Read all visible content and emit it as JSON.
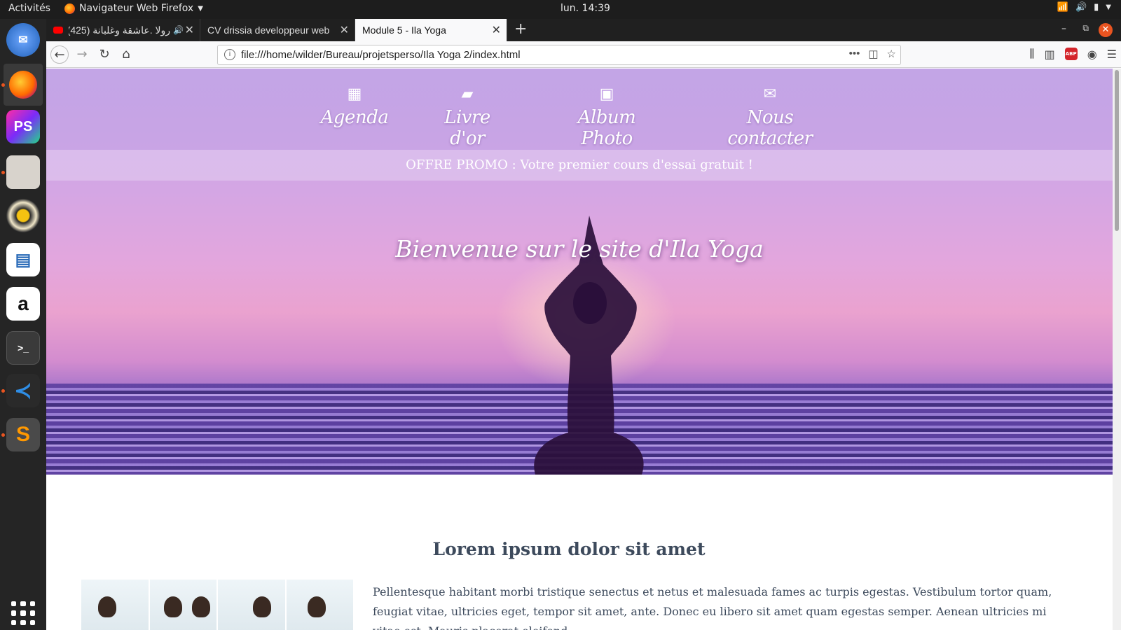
{
  "system": {
    "activities": "Activités",
    "app_menu": "Navigateur Web Firefox",
    "clock": "lun. 14:39"
  },
  "browser": {
    "tabs": [
      {
        "title": "رولا .عاشقة وغلبانة (425)",
        "audio": "🔊"
      },
      {
        "title": "CV drissia developpeur web"
      },
      {
        "title": "Module 5 - Ila Yoga"
      }
    ],
    "url": "file:///home/wilder/Bureau/projetsperso/Ila Yoga 2/index.html"
  },
  "page": {
    "nav": [
      {
        "label": "Agenda",
        "icon": "calendar-icon"
      },
      {
        "label": "Livre d'or",
        "icon": "book-icon"
      },
      {
        "label": "Album Photo",
        "icon": "image-icon"
      },
      {
        "label": "Nous contacter",
        "icon": "envelope-icon"
      }
    ],
    "promo": "OFFRE PROMO : Votre premier cours d'essai gratuit !",
    "welcome": "Bienvenue sur le site d'Ila Yoga",
    "section_title": "Lorem ipsum dolor sit amet",
    "section_text": "Pellentesque habitant morbi tristique senectus et netus et malesuada fames ac turpis egestas. Vestibulum tortor quam, feugiat vitae, ultricies eget, tempor sit amet, ante. Donec eu libero sit amet quam egestas semper. Aenean ultricies mi vitae est. Mauris placerat eleifend"
  },
  "colors": {
    "ubuntu_orange": "#e95420",
    "text_slate": "#3d4a5c",
    "hero_lilac": "#c6a8e6"
  }
}
